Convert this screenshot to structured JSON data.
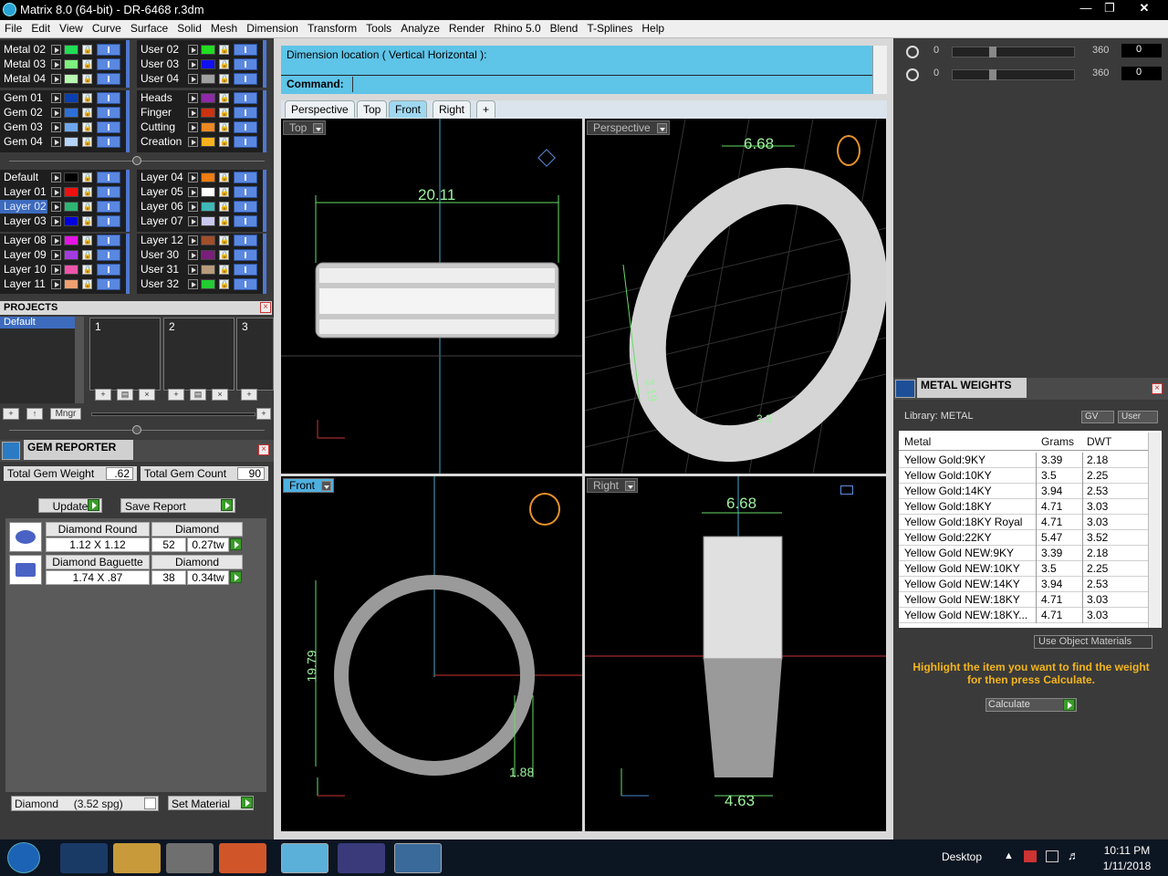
{
  "window": {
    "title": "Matrix 8.0 (64-bit) - DR-6468 r.3dm"
  },
  "menu": [
    "File",
    "Edit",
    "View",
    "Curve",
    "Surface",
    "Solid",
    "Mesh",
    "Dimension",
    "Transform",
    "Tools",
    "Analyze",
    "Render",
    "Rhino 5.0",
    "Blend",
    "T-Splines",
    "Help"
  ],
  "layers_left": [
    {
      "name": "Metal 02",
      "color": "#22dd55"
    },
    {
      "name": "Metal 03",
      "color": "#7ef07e"
    },
    {
      "name": "Metal 04",
      "color": "#b8f7b0"
    },
    {
      "name": "Gem 01",
      "color": "#0a3fb0"
    },
    {
      "name": "Gem 02",
      "color": "#2e6fd6"
    },
    {
      "name": "Gem 03",
      "color": "#6ea6ee"
    },
    {
      "name": "Gem 04",
      "color": "#b6d3f8"
    },
    {
      "name": "Default",
      "color": "#000000"
    },
    {
      "name": "Layer 01",
      "color": "#ee1111"
    },
    {
      "name": "Layer 02",
      "color": "#2fb572",
      "selected": true
    },
    {
      "name": "Layer 03",
      "color": "#0000dd"
    },
    {
      "name": "Layer 08",
      "color": "#e415e4"
    },
    {
      "name": "Layer 09",
      "color": "#a33ce0"
    },
    {
      "name": "Layer 10",
      "color": "#ee55aa"
    },
    {
      "name": "Layer 11",
      "color": "#f0a070"
    }
  ],
  "layers_right": [
    {
      "name": "User 02",
      "color": "#22dd22"
    },
    {
      "name": "User 03",
      "color": "#1111ee"
    },
    {
      "name": "User 04",
      "color": "#a0a0a0"
    },
    {
      "name": "Heads",
      "color": "#8e2aa8"
    },
    {
      "name": "Finger",
      "color": "#cc3311"
    },
    {
      "name": "Cutting",
      "color": "#ee8822"
    },
    {
      "name": "Creation",
      "color": "#f7b21e"
    },
    {
      "name": "Layer 04",
      "color": "#f27d10"
    },
    {
      "name": "Layer 05",
      "color": "#ffffff"
    },
    {
      "name": "Layer 06",
      "color": "#3fb8b8"
    },
    {
      "name": "Layer 07",
      "color": "#c8c8f0"
    },
    {
      "name": "Layer 12",
      "color": "#a24e2a"
    },
    {
      "name": "User 30",
      "color": "#7a1f7a"
    },
    {
      "name": "User 31",
      "color": "#b89c7c"
    },
    {
      "name": "User 32",
      "color": "#22cc33"
    }
  ],
  "projects": {
    "title": "PROJECTS",
    "list_selected": "Default",
    "slots": [
      "1",
      "2",
      "3"
    ],
    "mngr_label": "Mngr"
  },
  "gem_reporter": {
    "title": "GEM REPORTER",
    "total_weight_label": "Total Gem Weight",
    "total_weight": ".62",
    "total_count_label": "Total Gem Count",
    "total_count": "90",
    "update_label": "Update",
    "save_label": "Save Report",
    "gems": [
      {
        "name": "Diamond Round",
        "material": "Diamond",
        "size": "1.12 X 1.12",
        "count": "52",
        "weight": "0.27tw"
      },
      {
        "name": "Diamond Baguette",
        "material": "Diamond",
        "size": "1.74 X .87",
        "count": "38",
        "weight": "0.34tw"
      }
    ],
    "material_select": "Diamond     (3.52 spg)",
    "set_material_label": "Set Material"
  },
  "command": {
    "prompt": "Dimension location ( Vertical  Horizontal ):",
    "label": "Command:"
  },
  "view_tabs": [
    "Perspective",
    "Top",
    "Front",
    "Right",
    "+"
  ],
  "active_tab": "Front",
  "viewports": {
    "top": {
      "label": "Top",
      "dim": "20.11"
    },
    "perspective": {
      "label": "Perspective",
      "dim": "6.68",
      "dim2": "3.19",
      "dim3": "3.3"
    },
    "front": {
      "label": "Front",
      "dim_v": "19.79",
      "dim_h": "1.88"
    },
    "right": {
      "label": "Right",
      "dim_top": "6.68",
      "dim_bottom": "4.63"
    }
  },
  "rotation": {
    "min1": "0",
    "max1": "360",
    "val1": "0",
    "min2": "0",
    "max2": "360",
    "val2": "0"
  },
  "metal_weights": {
    "title": "METAL WEIGHTS",
    "library": "Library: METAL",
    "btn_gv": "GV",
    "btn_user": "User",
    "columns": [
      "Metal",
      "Grams",
      "DWT"
    ],
    "rows": [
      [
        "Yellow Gold:9KY",
        "3.39",
        "2.18"
      ],
      [
        "Yellow Gold:10KY",
        "3.5",
        "2.25"
      ],
      [
        "Yellow Gold:14KY",
        "3.94",
        "2.53"
      ],
      [
        "Yellow Gold:18KY",
        "4.71",
        "3.03"
      ],
      [
        "Yellow Gold:18KY Royal",
        "4.71",
        "3.03"
      ],
      [
        "Yellow Gold:22KY",
        "5.47",
        "3.52"
      ],
      [
        "Yellow Gold NEW:9KY",
        "3.39",
        "2.18"
      ],
      [
        "Yellow Gold NEW:10KY",
        "3.5",
        "2.25"
      ],
      [
        "Yellow Gold NEW:14KY",
        "3.94",
        "2.53"
      ],
      [
        "Yellow Gold NEW:18KY",
        "4.71",
        "3.03"
      ],
      [
        "Yellow Gold NEW:18KY...",
        "4.71",
        "3.03"
      ]
    ],
    "use_object_materials": "Use Object Materials",
    "hint": "Highlight the item you want to find the weight for then press Calculate.",
    "calculate_label": "Calculate"
  },
  "taskbar": {
    "desktop": "Desktop",
    "time": "10:11 PM",
    "date": "1/11/2018"
  }
}
